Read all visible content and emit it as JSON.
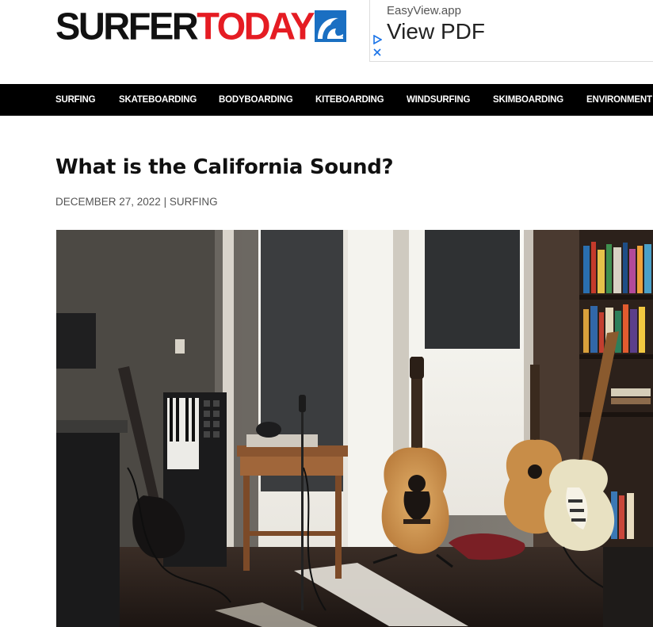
{
  "header": {
    "logo_primary": "SURFER",
    "logo_secondary": "TODAY",
    "logo_icon": "wave-icon"
  },
  "ad": {
    "domain": "EasyView.app",
    "cta": "View PDF",
    "icons": [
      "adchoices-icon",
      "close-icon"
    ]
  },
  "nav": {
    "items": [
      "SURFING",
      "SKATEBOARDING",
      "BODYBOARDING",
      "KITEBOARDING",
      "WINDSURFING",
      "SKIMBOARDING",
      "ENVIRONMENT"
    ]
  },
  "article": {
    "title": "What is the California Sound?",
    "date": "DECEMBER 27, 2022",
    "separator": " | ",
    "category": "SURFING"
  },
  "colors": {
    "brand_red": "#e51c23",
    "brand_blue": "#1a6fc2",
    "nav_bg": "#000000",
    "ad_link": "#1a73e8"
  }
}
